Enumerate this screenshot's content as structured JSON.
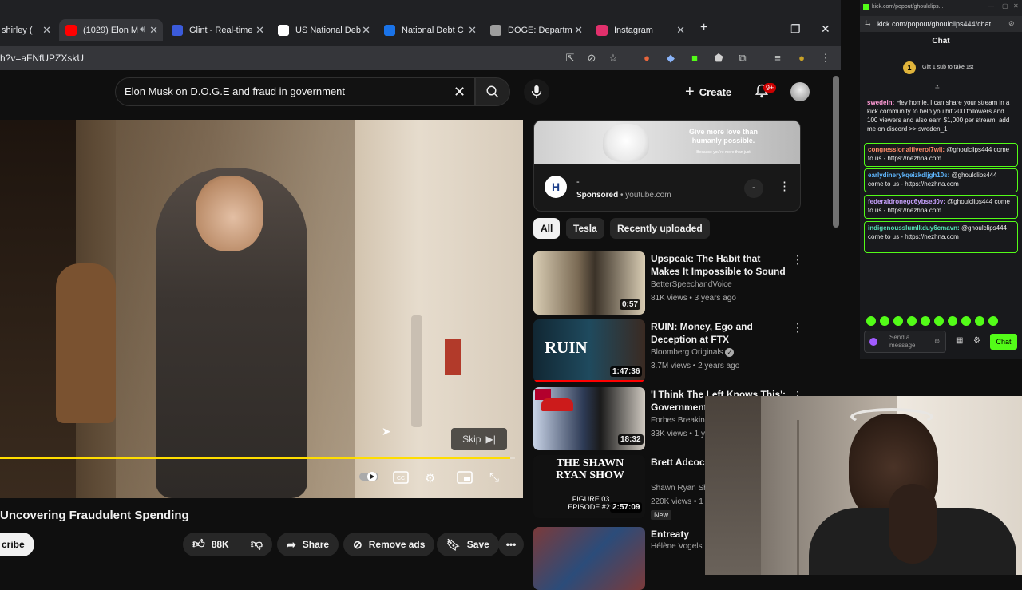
{
  "browser": {
    "tabs": [
      {
        "label": "shirley (",
        "color": "#5f6368",
        "active": false
      },
      {
        "label": "(1029) Elon M",
        "color": "#ff0000",
        "active": true
      },
      {
        "label": "Glint - Real-time",
        "color": "#3b5bdb",
        "active": false
      },
      {
        "label": "US National Deb",
        "color": "#ffffff",
        "active": false
      },
      {
        "label": "National Debt C",
        "color": "#1a73e8",
        "active": false
      },
      {
        "label": "DOGE: Departm",
        "color": "#9e9e9e",
        "active": false
      },
      {
        "label": "Instagram",
        "color": "#e1306c",
        "active": false
      }
    ],
    "url": "h?v=aFNfUPZXskU"
  },
  "youtube": {
    "search_value": "Elon Musk on D.O.G.E and fraud in government",
    "create_label": "Create",
    "notification_badge": "9+",
    "video": {
      "title": "Uncovering Fraudulent Spending",
      "skip_label": "Skip",
      "progress": 0.99,
      "subscribe_label": "cribe",
      "likes": "88K",
      "share_label": "Share",
      "remove_ads_label": "Remove ads",
      "save_label": "Save"
    },
    "ad": {
      "headline": "Give more love than humanly possible.",
      "small": "Because you're more than just",
      "logo": "H",
      "dash": "-",
      "sponsored": "Sponsored",
      "domain": "youtube.com",
      "button": "-"
    },
    "chips": [
      "All",
      "Tesla",
      "Recently uploaded"
    ],
    "recommendations": [
      {
        "title": "Upspeak: The Habit that Makes It Impossible to Sound ...",
        "channel": "BetterSpeechandVoice",
        "meta": "81K views • 3 years ago",
        "duration": "0:57",
        "thumb": "#7a6a54",
        "new": ""
      },
      {
        "title": "RUIN: Money, Ego and Deception at FTX",
        "channel": "Bloomberg Originals",
        "meta": "3.7M views • 2 years ago",
        "duration": "1:47:36",
        "thumb": "#17384a",
        "thumb_text": "RUIN",
        "verified": "✓",
        "new": ""
      },
      {
        "title": "'I Think The Left Knows This': Government",
        "channel": "Forbes Breakin",
        "meta": "33K views • 1 y",
        "duration": "18:32",
        "thumb": "#2d3a55",
        "new": ""
      },
      {
        "title": "Brett Adcock First Intervie",
        "channel": "Shawn Ryan Sh",
        "meta": "220K views • 1",
        "duration": "2:57:09",
        "thumb": "#111111",
        "thumb_text": "THE SHAWN RYAN SHOW",
        "thumb_sub": "FIGURE 03 EPISODE #29",
        "new": "New"
      },
      {
        "title": "Entreaty",
        "channel": "Hélène Vogels",
        "meta": "",
        "duration": "",
        "thumb": "#7b3a3a",
        "new": ""
      }
    ]
  },
  "kick": {
    "site": "kick.com/popout/ghoulclips...",
    "url": "kick.com/popout/ghoulclips444/chat",
    "header": "Chat",
    "gift_count": "1",
    "gift_text": "Gift 1 sub to take 1st",
    "messages": [
      {
        "user": "swedein:",
        "text": "Hey homie, I can share your stream in a kick community to help you hit 200 followers and 100 viewers and also earn $1,000 per stream, add me on discord >> sweden_1",
        "color": "#ff9ad5",
        "boxed": false
      },
      {
        "user": "congressionalfiveroi7wij:",
        "text": "@ghoulclips444 come to us - https://nezhna.com",
        "color": "#ff8c69",
        "boxed": true
      },
      {
        "user": "earlydinerykqeizkdljgh10s:",
        "text": "@ghoulclips444 come to us - https://nezhna.com",
        "color": "#5fb7ff",
        "boxed": true
      },
      {
        "user": "federaldronegc6ybsed0v:",
        "text": "@ghoulclips444 come to us - https://nezhna.com",
        "color": "#c8a2ff",
        "boxed": true
      },
      {
        "user": "indigenousslumlkduy6cmavn:",
        "text": "@ghoulclips444 come to us - https://nezhna.com",
        "color": "#58e0b8",
        "boxed": true
      }
    ],
    "input_placeholder": "Send a message",
    "chat_button": "Chat",
    "accent": "#53fc18"
  }
}
